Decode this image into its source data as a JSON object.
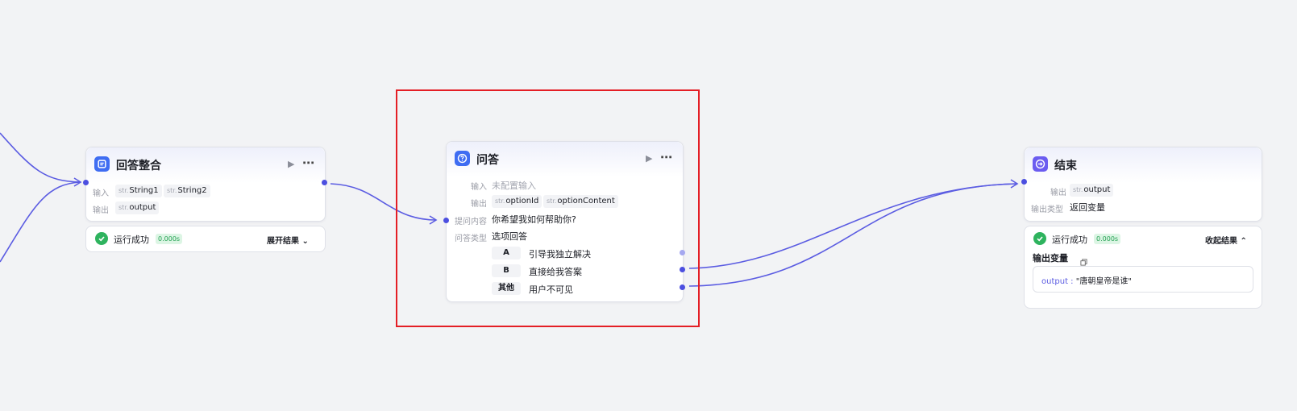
{
  "colors": {
    "accent": "#4c4fe0",
    "success": "#2eb35e",
    "highlight": "#e41e25",
    "canvas": "#f2f3f5"
  },
  "node_merge": {
    "icon": "answer-merge-icon",
    "title": "回答整合",
    "run_icon": "▶",
    "more_icon": "⋯",
    "input_label": "输入",
    "inputs": [
      {
        "type": "str.",
        "name": "String1"
      },
      {
        "type": "str.",
        "name": "String2"
      }
    ],
    "output_label": "输出",
    "outputs": [
      {
        "type": "str.",
        "name": "output"
      }
    ],
    "status": {
      "text": "运行成功",
      "time": "0.000s",
      "toggle": "展开结果 ⌄"
    }
  },
  "node_question": {
    "icon": "question-icon",
    "title": "问答",
    "run_icon": "▶",
    "more_icon": "⋯",
    "input_label": "输入",
    "input_value": "未配置输入",
    "output_label": "输出",
    "outputs": [
      {
        "type": "str.",
        "name": "optionId"
      },
      {
        "type": "str.",
        "name": "optionContent"
      }
    ],
    "question_label": "提问内容",
    "question_value": "你希望我如何帮助你?",
    "answer_type_label": "问答类型",
    "answer_type_value": "选项回答",
    "options": [
      {
        "key": "A",
        "text": "引导我独立解决"
      },
      {
        "key": "B",
        "text": "直接给我答案"
      },
      {
        "key": "其他",
        "text": "用户不可见"
      }
    ]
  },
  "node_end": {
    "icon": "end-icon",
    "title": "结束",
    "output_label": "输出",
    "outputs": [
      {
        "type": "str.",
        "name": "output"
      }
    ],
    "output_type_label": "输出类型",
    "output_type_value": "返回变量",
    "status": {
      "text": "运行成功",
      "time": "0.000s",
      "toggle": "收起结果 ⌃",
      "result_title": "输出变量",
      "result_key": "output",
      "result_sep": " : ",
      "result_value": "\"唐朝皇帝是谁\""
    }
  }
}
